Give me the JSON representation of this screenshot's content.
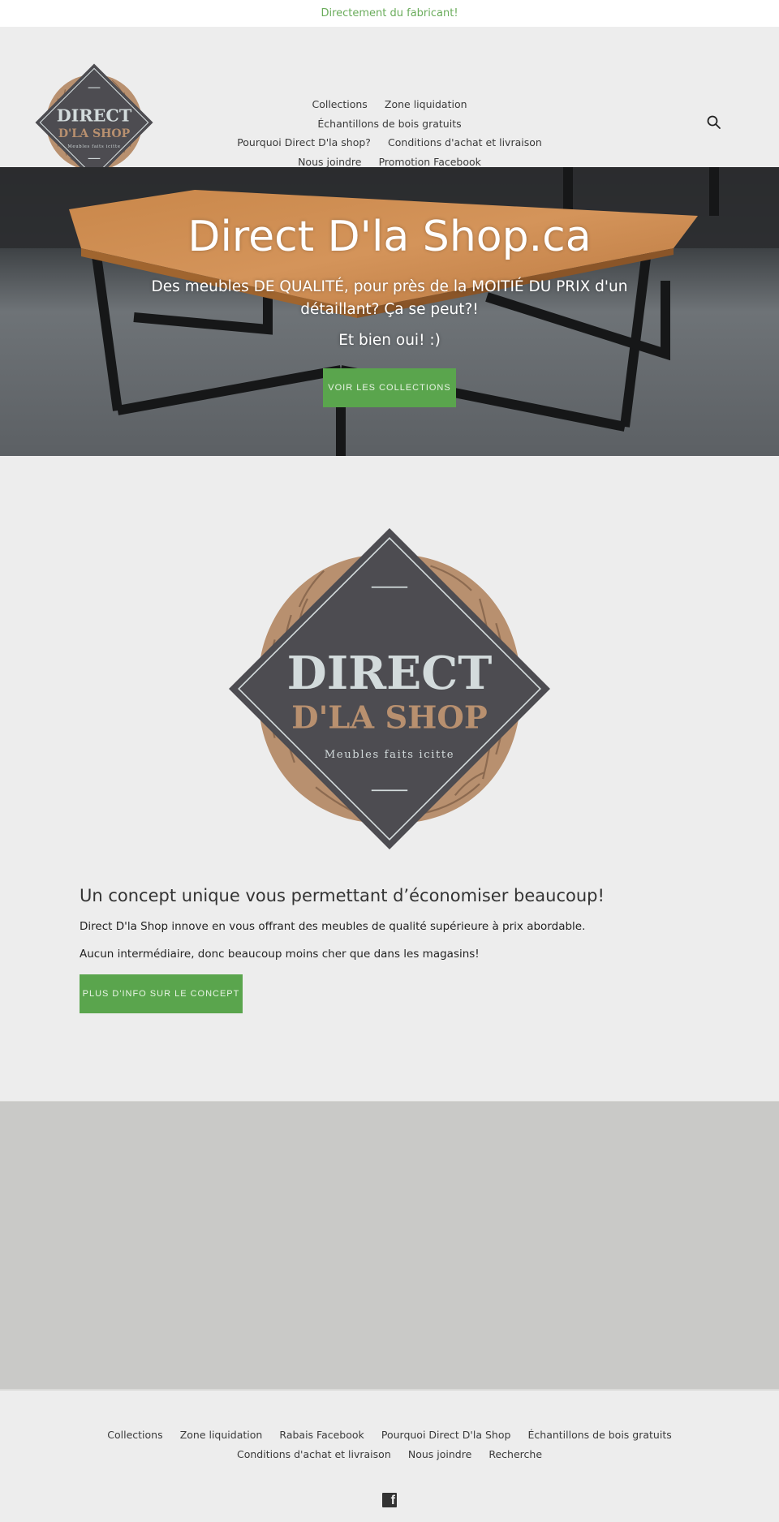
{
  "announcement": {
    "text": "Directement du fabricant!",
    "color": "#6aac5b"
  },
  "header": {
    "logo": {
      "line1": "DIRECT",
      "line2": "D'LA SHOP",
      "tagline": "Meubles faits icitte"
    },
    "nav": [
      {
        "label": "Collections"
      },
      {
        "label": "Zone liquidation"
      },
      {
        "label": "Échantillons de bois gratuits"
      },
      {
        "label": "Pourquoi Direct D'la shop?"
      },
      {
        "label": "Conditions d'achat et livraison"
      },
      {
        "label": "Nous joindre"
      },
      {
        "label": "Promotion Facebook"
      }
    ],
    "search_icon": "search-icon"
  },
  "hero": {
    "title": "Direct D'la Shop.ca",
    "subtitle": "Des meubles DE QUALITÉ, pour près de la MOITIÉ DU PRIX d'un détaillant? Ça se peut?!",
    "subtitle2": "Et bien oui! :)",
    "button_label": "VOIR LES COLLECTIONS"
  },
  "concept": {
    "logo": {
      "line1": "DIRECT",
      "line2": "D'LA SHOP",
      "tagline": "Meubles faits icitte"
    },
    "heading": "Un concept unique vous permettant d’économiser beaucoup!",
    "paragraph1": "Direct D'la Shop innove en vous offrant des meubles de qualité supérieure à prix abordable.",
    "paragraph2": "Aucun intermédiaire, donc beaucoup moins cher que dans les magasins!",
    "button_label": "PLUS D'INFO SUR LE CONCEPT"
  },
  "footer": {
    "links": [
      {
        "label": "Collections"
      },
      {
        "label": "Zone liquidation"
      },
      {
        "label": "Rabais Facebook"
      },
      {
        "label": "Pourquoi Direct D'la Shop"
      },
      {
        "label": "Échantillons de bois gratuits"
      },
      {
        "label": "Conditions d'achat et livraison"
      },
      {
        "label": "Nous joindre"
      },
      {
        "label": "Recherche"
      }
    ],
    "social": [
      {
        "icon": "facebook-icon",
        "glyph": "f"
      }
    ]
  },
  "colors": {
    "accent_green": "#5aa54d",
    "logo_dark": "#4d4c51",
    "logo_wood": "#b8906f",
    "logo_text_light": "#d3dbdc"
  }
}
